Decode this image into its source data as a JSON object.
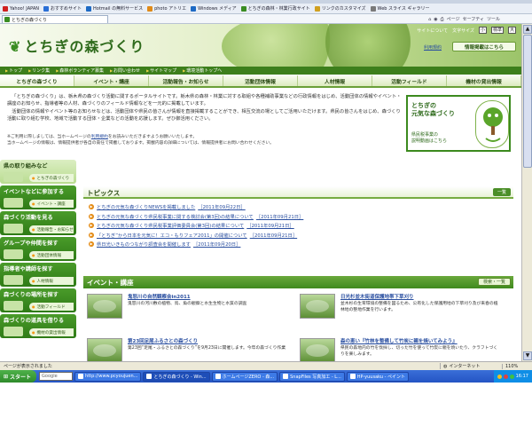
{
  "browser": {
    "favorites": [
      {
        "label": "Yahoo! JAPAN",
        "color": "#d02020"
      },
      {
        "label": "おすすめサイト",
        "color": "#2b6fd6"
      },
      {
        "label": "Hotmail の無料サービス",
        "color": "#1e6ac4"
      },
      {
        "label": "photo アトリエ",
        "color": "#e08a18"
      },
      {
        "label": "Windows メディア",
        "color": "#1e6ac4"
      },
      {
        "label": "とちぎの森林・林業行政サイト",
        "color": "#3a8c22"
      },
      {
        "label": "リンクのカスタマイズ",
        "color": "#d0a020"
      },
      {
        "label": "Web スライス ギャラリー",
        "color": "#7a7a7a"
      }
    ],
    "tab_title": "とちぎの森づくり",
    "toolbar": [
      "ページ",
      "セーフティ",
      "ツール"
    ]
  },
  "header": {
    "title": "とちぎの森づくり",
    "links": [
      "サイトについて",
      "文字サイズ"
    ],
    "font_sizes": [
      "小",
      "標準",
      "大"
    ],
    "login": "利用規約",
    "post_button": "情報掲載はこちら"
  },
  "utilbar": [
    "トップ",
    "リンク集",
    "森林ボランティア募集",
    "お問い合わせ",
    "サイトマップ",
    "環境活動トップへ"
  ],
  "nav": [
    "とちぎの森づくり",
    "イベント・講座",
    "活動報告・お知らせ",
    "活動団体情報",
    "人材情報",
    "活動フィールド",
    "機材の貸出情報"
  ],
  "intro": {
    "p1": "「とちぎの森づくり」は、栃木県の森づくり活動に関するポータルサイトです。栃木県の森林・林業に対する取組や各種補助事業などの行政情報をはじめ、活動団体の情報やイベント・講座のお知らせ、指導者等の人材、森づくりのフィールド情報などを一元的に掲載しています。",
    "p2": "活動団体の情報やイベント等のお知らせなどは、活動団体や県民の皆さんが情報を直接掲載することができ、相互交流の場としてご活用いただけます。県民の皆さんをはじめ、森づくり活動に取り組む学校、地域で活動する団体・企業などの活動を応援します。ぜひ御活用ください。",
    "note1_pre": "※ご利用に際しましては、当ホームページの",
    "note1_link": "利用規約",
    "note1_post": "をお読みいただきますようお願いいたします。",
    "note2": "当ホームページの情報は、情報提供者が各自の責任で掲載しております。掲載内容の詳細については、情報提供者にお問い合わせください。"
  },
  "banner": {
    "line1": "とちぎの",
    "line2": "元気な森づくり",
    "line3": "県民税事業の",
    "line4": "説明動画はこちら",
    "logo_text": "とちぎの元気な森づくり"
  },
  "sidebar": [
    {
      "label": "県の取り組みなど",
      "sub": "とちぎの森づくり"
    },
    {
      "label": "イベントなどに参加する",
      "sub": "イベント・講座"
    },
    {
      "label": "森づくり活動を見る",
      "sub": "活動報告・お知らせ"
    },
    {
      "label": "グループや仲間を探す",
      "sub": "活動団体情報"
    },
    {
      "label": "指導者や講師を探す",
      "sub": "人材情報"
    },
    {
      "label": "森づくりの場所を探す",
      "sub": "活動フィールド"
    },
    {
      "label": "森づくりの道具を借りる",
      "sub": "機材の貸出情報"
    }
  ],
  "topics": {
    "title": "トピックス",
    "button": "一覧",
    "items": [
      {
        "title": "とちぎの元気な森づくりNEWSを掲載しました",
        "date": "［2011年09月22日］"
      },
      {
        "title": "とちぎの元気な森づくり県民税事業に関する検討会(第3回)の結果について",
        "date": "［2011年09月21日］"
      },
      {
        "title": "とちぎの元気な森づくり県民税事業評価委員会(第3回)の結果について",
        "date": "［2011年09月21日］"
      },
      {
        "title": "「とちぎ”から日本を元気に！エコ・もりフェア2011」の開催について",
        "date": "［2011年09月21日］"
      },
      {
        "title": "県日光いきものつながり調査会を開催します",
        "date": "［2011年09月20日］"
      }
    ]
  },
  "events": {
    "title": "イベント・講座",
    "button": "検索・一覧",
    "items": [
      {
        "title": "鬼怒川の自然観察会in2011",
        "desc": "鬼怒川の河川敷の植物、鳥、魚の観察と水生生物と水質の調査"
      },
      {
        "title": "日光杉並木街道保護地帯下草刈り",
        "desc": "並木杉の生育環境の整備を図るため、公有化した保護用地の下草刈り及び来春の植林地の整地作業を行います。"
      },
      {
        "title": "第23回足尾ふるさとの森づくり",
        "desc": "第23回“足尾・ふるさとの森づくり”を9月23日に開催します。今年の森づくり作業"
      },
      {
        "title": "森の恵い『竹林を整備して竹炭に親を焼いてみよう』",
        "desc": "県民の森地内の竹を伐採し、切った竹を使って竹炭に親を焼いたり、クラフトづくりを楽しみます。"
      }
    ]
  },
  "status": {
    "text": "ページが表示されました",
    "zone": "インターネット",
    "zoom": "110%"
  },
  "taskbar": {
    "start": "スタート",
    "search": "Google",
    "tasks": [
      {
        "label": "http://www.pcyoujuen...",
        "active": false
      },
      {
        "label": "とちぎの森づくり - Win...",
        "active": true
      },
      {
        "label": "ホームページZERO - 森...",
        "active": false
      },
      {
        "label": "SnapFiles 写真加工 - L...",
        "active": false
      },
      {
        "label": "HP-yuusaku - ペイント",
        "active": false
      }
    ],
    "clock": "16:17"
  }
}
